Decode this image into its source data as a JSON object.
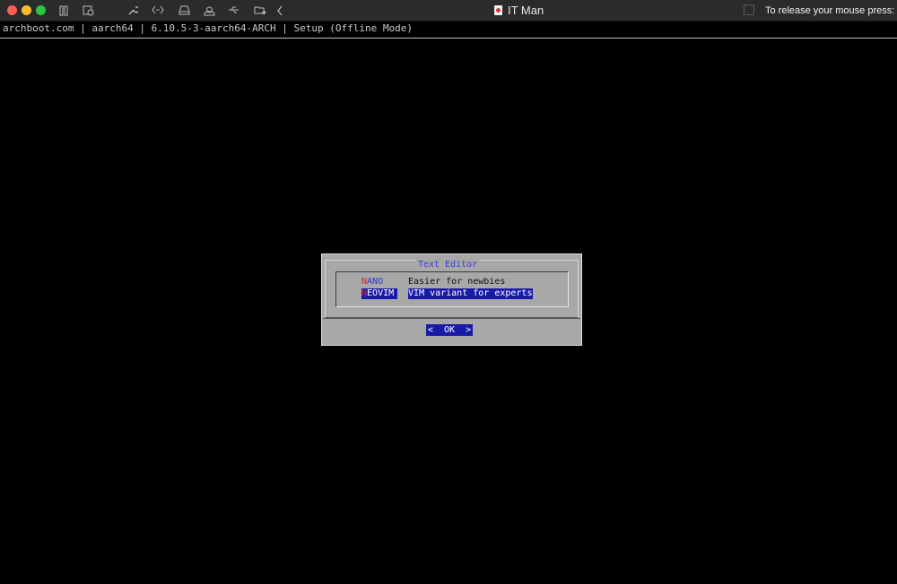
{
  "window": {
    "title": "IT Man",
    "release_hint": "To release your mouse press: Cont"
  },
  "toolbar": {
    "icons": [
      "pause-icon",
      "snapshot-icon",
      "settings-wrench-icon",
      "code-brackets-icon",
      "drive-icon",
      "user-icon",
      "usb-icon",
      "folder-share-icon",
      "chevron-left-icon"
    ]
  },
  "terminal": {
    "header": "archboot.com | aarch64 | 6.10.5-3-aarch64-ARCH | Setup (Offline Mode)"
  },
  "dialog": {
    "title": "Text Editor",
    "items": [
      {
        "hotkey": "N",
        "tag_rest": "ANO",
        "description": "Easier for newbies",
        "selected": false
      },
      {
        "hotkey": "N",
        "tag_rest": "EOVIM",
        "description": "VIM variant for experts",
        "selected": true
      }
    ],
    "ok_label": "OK",
    "ok_left": "<",
    "ok_right": ">"
  },
  "colors": {
    "dialog_bg": "#a8a8a8",
    "title_blue": "#3a3ad8",
    "selection_blue": "#1a1aa8",
    "hotkey_red": "#e02020"
  }
}
